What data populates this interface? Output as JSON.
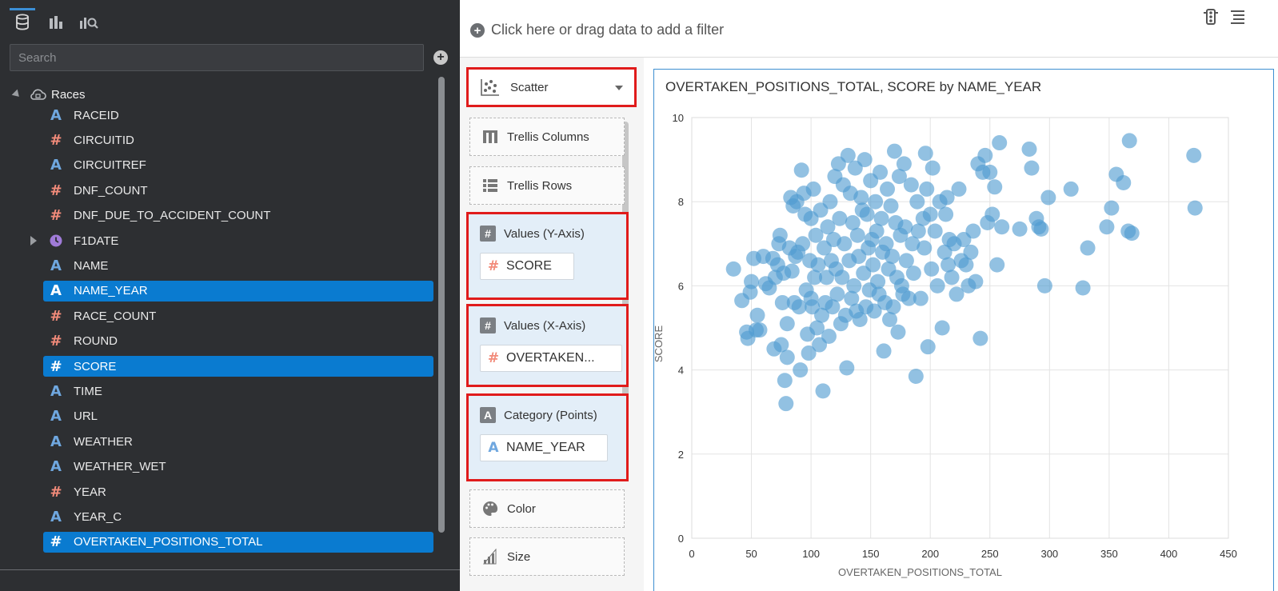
{
  "left_panel": {
    "tabs": [
      {
        "name": "data-tab",
        "icon": "database-icon"
      },
      {
        "name": "visualizations-tab",
        "icon": "bar-chart-icon"
      },
      {
        "name": "analytics-tab",
        "icon": "analytics-search-icon"
      }
    ],
    "search_placeholder": "Search",
    "tree": {
      "root_label": "Races",
      "items": [
        {
          "label": "RACEID",
          "type": "A",
          "selected": false
        },
        {
          "label": "CIRCUITID",
          "type": "#",
          "selected": false
        },
        {
          "label": "CIRCUITREF",
          "type": "A",
          "selected": false
        },
        {
          "label": "DNF_COUNT",
          "type": "#",
          "selected": false
        },
        {
          "label": "DNF_DUE_TO_ACCIDENT_COUNT",
          "type": "#",
          "selected": false
        },
        {
          "label": "F1DATE",
          "type": "clock",
          "selected": false
        },
        {
          "label": "NAME",
          "type": "A",
          "selected": false
        },
        {
          "label": "NAME_YEAR",
          "type": "A",
          "selected": true
        },
        {
          "label": "RACE_COUNT",
          "type": "#",
          "selected": false
        },
        {
          "label": "ROUND",
          "type": "#",
          "selected": false
        },
        {
          "label": "SCORE",
          "type": "#",
          "selected": true
        },
        {
          "label": "TIME",
          "type": "A",
          "selected": false
        },
        {
          "label": "URL",
          "type": "A",
          "selected": false
        },
        {
          "label": "WEATHER",
          "type": "A",
          "selected": false
        },
        {
          "label": "WEATHER_WET",
          "type": "A",
          "selected": false
        },
        {
          "label": "YEAR",
          "type": "#",
          "selected": false
        },
        {
          "label": "YEAR_C",
          "type": "A",
          "selected": false
        },
        {
          "label": "OVERTAKEN_POSITIONS_TOTAL",
          "type": "#",
          "selected": true
        }
      ]
    }
  },
  "filter_bar": {
    "text": "Click here or drag data to add a filter"
  },
  "grammar": {
    "chart_type": "Scatter",
    "trellis_columns": "Trellis Columns",
    "trellis_rows": "Trellis Rows",
    "y_axis": {
      "title": "Values (Y-Axis)",
      "pill": "SCORE"
    },
    "x_axis": {
      "title": "Values (X-Axis)",
      "pill": "OVERTAKEN..."
    },
    "category": {
      "title": "Category (Points)",
      "pill": "NAME_YEAR"
    },
    "color": "Color",
    "size": "Size"
  },
  "colors": {
    "accent": "#0a7bd0",
    "highlight_border": "#e01b1b",
    "point": "#4f9bd0"
  },
  "chart_data": {
    "type": "scatter",
    "title": "OVERTAKEN_POSITIONS_TOTAL, SCORE by NAME_YEAR",
    "xlabel": "OVERTAKEN_POSITIONS_TOTAL",
    "ylabel": "SCORE",
    "xlim": [
      0,
      450
    ],
    "ylim": [
      0,
      10
    ],
    "xticks": [
      "0",
      "50",
      "100",
      "150",
      "200",
      "250",
      "300",
      "350",
      "400",
      "450"
    ],
    "yticks": [
      "0",
      "2",
      "4",
      "6",
      "8",
      "10"
    ],
    "grid": true,
    "points": [
      [
        35,
        6.4
      ],
      [
        42,
        5.65
      ],
      [
        46,
        4.9
      ],
      [
        47,
        4.75
      ],
      [
        49,
        5.85
      ],
      [
        50,
        6.1
      ],
      [
        52,
        6.65
      ],
      [
        54,
        4.95
      ],
      [
        55,
        5.3
      ],
      [
        57,
        4.95
      ],
      [
        60,
        6.7
      ],
      [
        62,
        6.05
      ],
      [
        65,
        5.95
      ],
      [
        68,
        6.65
      ],
      [
        69,
        4.5
      ],
      [
        70,
        6.2
      ],
      [
        72,
        6.5
      ],
      [
        73,
        7.0
      ],
      [
        74,
        7.2
      ],
      [
        75,
        4.6
      ],
      [
        76,
        5.6
      ],
      [
        77,
        6.3
      ],
      [
        78,
        3.75
      ],
      [
        79,
        3.2
      ],
      [
        80,
        4.3
      ],
      [
        80,
        5.1
      ],
      [
        82,
        6.9
      ],
      [
        83,
        8.1
      ],
      [
        84,
        6.35
      ],
      [
        85,
        7.9
      ],
      [
        86,
        5.6
      ],
      [
        87,
        6.7
      ],
      [
        88,
        8.0
      ],
      [
        89,
        6.8
      ],
      [
        90,
        5.5
      ],
      [
        91,
        4.0
      ],
      [
        92,
        8.75
      ],
      [
        93,
        7.0
      ],
      [
        94,
        8.2
      ],
      [
        95,
        7.7
      ],
      [
        96,
        5.9
      ],
      [
        97,
        4.85
      ],
      [
        98,
        4.4
      ],
      [
        99,
        6.6
      ],
      [
        100,
        7.6
      ],
      [
        100,
        5.7
      ],
      [
        101,
        5.5
      ],
      [
        102,
        8.3
      ],
      [
        103,
        6.2
      ],
      [
        104,
        7.2
      ],
      [
        105,
        5.0
      ],
      [
        106,
        6.5
      ],
      [
        107,
        4.6
      ],
      [
        108,
        7.8
      ],
      [
        109,
        5.3
      ],
      [
        110,
        3.5
      ],
      [
        111,
        6.9
      ],
      [
        112,
        5.6
      ],
      [
        113,
        6.2
      ],
      [
        114,
        7.4
      ],
      [
        115,
        4.8
      ],
      [
        116,
        8.0
      ],
      [
        117,
        6.6
      ],
      [
        118,
        5.5
      ],
      [
        119,
        7.1
      ],
      [
        120,
        8.6
      ],
      [
        121,
        6.4
      ],
      [
        122,
        5.8
      ],
      [
        123,
        8.9
      ],
      [
        124,
        7.6
      ],
      [
        125,
        5.1
      ],
      [
        126,
        6.2
      ],
      [
        127,
        8.4
      ],
      [
        128,
        7.0
      ],
      [
        129,
        5.3
      ],
      [
        130,
        4.05
      ],
      [
        131,
        9.1
      ],
      [
        132,
        6.6
      ],
      [
        133,
        8.2
      ],
      [
        134,
        5.7
      ],
      [
        135,
        7.5
      ],
      [
        136,
        6.0
      ],
      [
        137,
        8.8
      ],
      [
        138,
        5.4
      ],
      [
        139,
        7.2
      ],
      [
        140,
        6.7
      ],
      [
        141,
        5.2
      ],
      [
        142,
        8.1
      ],
      [
        143,
        7.8
      ],
      [
        144,
        6.3
      ],
      [
        145,
        9.0
      ],
      [
        146,
        5.5
      ],
      [
        147,
        7.7
      ],
      [
        148,
        6.9
      ],
      [
        149,
        5.9
      ],
      [
        150,
        8.5
      ],
      [
        151,
        7.1
      ],
      [
        152,
        6.5
      ],
      [
        153,
        5.4
      ],
      [
        154,
        8.0
      ],
      [
        155,
        7.3
      ],
      [
        156,
        6.1
      ],
      [
        157,
        5.8
      ],
      [
        158,
        8.7
      ],
      [
        159,
        7.6
      ],
      [
        160,
        6.8
      ],
      [
        161,
        4.45
      ],
      [
        162,
        5.6
      ],
      [
        163,
        7.0
      ],
      [
        164,
        8.3
      ],
      [
        165,
        6.4
      ],
      [
        166,
        5.2
      ],
      [
        167,
        7.9
      ],
      [
        168,
        6.7
      ],
      [
        169,
        5.5
      ],
      [
        170,
        9.2
      ],
      [
        171,
        7.5
      ],
      [
        172,
        6.2
      ],
      [
        173,
        4.9
      ],
      [
        174,
        8.6
      ],
      [
        175,
        7.2
      ],
      [
        176,
        6.0
      ],
      [
        177,
        5.8
      ],
      [
        178,
        8.9
      ],
      [
        179,
        7.4
      ],
      [
        180,
        6.6
      ],
      [
        182,
        5.7
      ],
      [
        184,
        8.4
      ],
      [
        185,
        7.0
      ],
      [
        186,
        6.3
      ],
      [
        188,
        3.85
      ],
      [
        189,
        8.0
      ],
      [
        190,
        7.3
      ],
      [
        192,
        5.7
      ],
      [
        194,
        7.6
      ],
      [
        195,
        6.9
      ],
      [
        196,
        9.15
      ],
      [
        197,
        8.3
      ],
      [
        198,
        4.55
      ],
      [
        200,
        7.7
      ],
      [
        201,
        6.4
      ],
      [
        202,
        8.8
      ],
      [
        204,
        7.3
      ],
      [
        206,
        6.0
      ],
      [
        208,
        8.0
      ],
      [
        210,
        5.0
      ],
      [
        212,
        6.8
      ],
      [
        213,
        7.7
      ],
      [
        214,
        8.1
      ],
      [
        215,
        6.5
      ],
      [
        216,
        7.1
      ],
      [
        218,
        6.2
      ],
      [
        220,
        7.0
      ],
      [
        222,
        5.8
      ],
      [
        224,
        8.3
      ],
      [
        226,
        6.6
      ],
      [
        228,
        7.1
      ],
      [
        230,
        6.5
      ],
      [
        232,
        6.0
      ],
      [
        234,
        6.8
      ],
      [
        236,
        7.3
      ],
      [
        238,
        6.1
      ],
      [
        240,
        8.9
      ],
      [
        242,
        4.75
      ],
      [
        244,
        8.7
      ],
      [
        246,
        9.1
      ],
      [
        248,
        7.5
      ],
      [
        250,
        8.7
      ],
      [
        252,
        7.7
      ],
      [
        254,
        8.35
      ],
      [
        256,
        6.5
      ],
      [
        258,
        9.4
      ],
      [
        260,
        7.4
      ],
      [
        275,
        7.35
      ],
      [
        283,
        9.25
      ],
      [
        285,
        8.8
      ],
      [
        289,
        7.6
      ],
      [
        291,
        7.4
      ],
      [
        293,
        7.35
      ],
      [
        296,
        6.0
      ],
      [
        299,
        8.1
      ],
      [
        318,
        8.3
      ],
      [
        328,
        5.95
      ],
      [
        332,
        6.9
      ],
      [
        348,
        7.4
      ],
      [
        352,
        7.85
      ],
      [
        356,
        8.65
      ],
      [
        362,
        8.45
      ],
      [
        366,
        7.3
      ],
      [
        367,
        9.45
      ],
      [
        369,
        7.25
      ],
      [
        421,
        9.1
      ],
      [
        422,
        7.85
      ]
    ]
  }
}
